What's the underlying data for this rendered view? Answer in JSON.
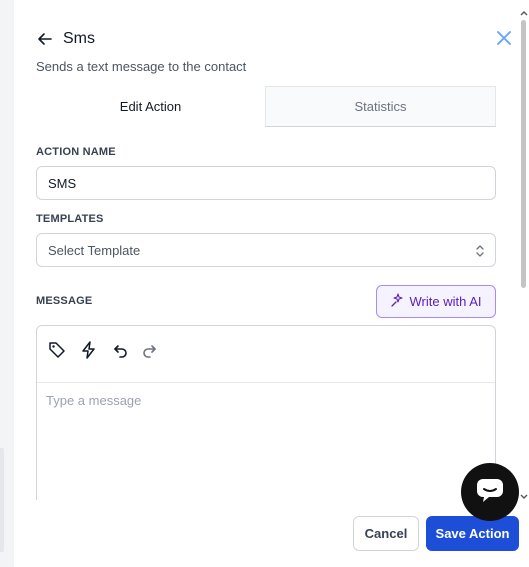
{
  "header": {
    "title": "Sms",
    "subtitle": "Sends a text message to the contact"
  },
  "tabs": [
    {
      "label": "Edit Action",
      "active": true
    },
    {
      "label": "Statistics",
      "active": false
    }
  ],
  "action_name": {
    "label": "ACTION NAME",
    "value": "SMS"
  },
  "templates": {
    "label": "TEMPLATES",
    "placeholder": "Select Template"
  },
  "message": {
    "label": "MESSAGE",
    "ai_button_label": "Write with AI",
    "placeholder": "Type a message",
    "toolbar_icons": [
      "tag-icon",
      "lightning-icon",
      "undo-icon",
      "redo-icon"
    ]
  },
  "footer": {
    "cancel_label": "Cancel",
    "save_label": "Save Action"
  },
  "colors": {
    "primary": "#1d4ed8",
    "ai_accent": "#5b21b6",
    "close_icon": "#60a5fa"
  }
}
